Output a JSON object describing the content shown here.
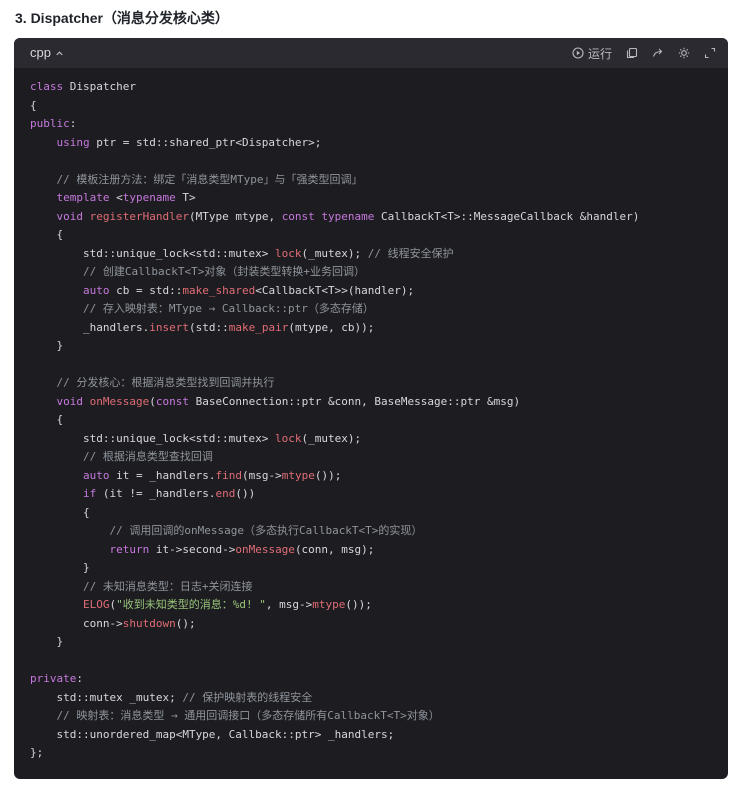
{
  "heading": "3. Dispatcher（消息分发核心类）",
  "code_block": {
    "language": "cpp",
    "run_label": "运行",
    "icons": [
      "play-icon",
      "copy-icon",
      "share-icon",
      "theme-icon",
      "expand-icon"
    ],
    "colors": {
      "background": "#1d1d21",
      "header": "#2a2a30",
      "keyword": "#c678dd",
      "function": "#e06c75",
      "comment": "#8f949c",
      "string": "#98c379",
      "text": "#d6d6dc"
    },
    "lines": [
      [
        [
          "kw",
          "class "
        ],
        [
          "tx",
          "Dispatcher"
        ]
      ],
      [
        [
          "tx",
          "{"
        ]
      ],
      [
        [
          "kw",
          "public"
        ],
        [
          "tx",
          ":"
        ]
      ],
      [
        [
          "tx",
          "    "
        ],
        [
          "kw",
          "using"
        ],
        [
          "tx",
          " ptr = std::shared_ptr<Dispatcher>;"
        ]
      ],
      [],
      [
        [
          "tx",
          "    "
        ],
        [
          "cm",
          "// 模板注册方法：绑定「消息类型MType」与「强类型回调」"
        ]
      ],
      [
        [
          "tx",
          "    "
        ],
        [
          "kw",
          "template"
        ],
        [
          "tx",
          " <"
        ],
        [
          "kw",
          "typename"
        ],
        [
          "tx",
          " T>"
        ]
      ],
      [
        [
          "tx",
          "    "
        ],
        [
          "kw",
          "void"
        ],
        [
          "tx",
          " "
        ],
        [
          "fn",
          "registerHandler"
        ],
        [
          "tx",
          "(MType mtype, "
        ],
        [
          "kw",
          "const"
        ],
        [
          "tx",
          " "
        ],
        [
          "kw",
          "typename"
        ],
        [
          "tx",
          " CallbackT<T>::MessageCallback &handler)"
        ]
      ],
      [
        [
          "tx",
          "    {"
        ]
      ],
      [
        [
          "tx",
          "        std::unique_lock<std::mutex> "
        ],
        [
          "fn",
          "lock"
        ],
        [
          "tx",
          "(_mutex); "
        ],
        [
          "cm",
          "// 线程安全保护"
        ]
      ],
      [
        [
          "tx",
          "        "
        ],
        [
          "cm",
          "// 创建CallbackT<T>对象（封装类型转换+业务回调）"
        ]
      ],
      [
        [
          "tx",
          "        "
        ],
        [
          "kw",
          "auto"
        ],
        [
          "tx",
          " cb = std::"
        ],
        [
          "fn",
          "make_shared"
        ],
        [
          "tx",
          "<CallbackT<T>>(handler);"
        ]
      ],
      [
        [
          "tx",
          "        "
        ],
        [
          "cm",
          "// 存入映射表：MType → Callback::ptr（多态存储）"
        ]
      ],
      [
        [
          "tx",
          "        _handlers."
        ],
        [
          "fn",
          "insert"
        ],
        [
          "tx",
          "(std::"
        ],
        [
          "fn",
          "make_pair"
        ],
        [
          "tx",
          "(mtype, cb));"
        ]
      ],
      [
        [
          "tx",
          "    }"
        ]
      ],
      [],
      [
        [
          "tx",
          "    "
        ],
        [
          "cm",
          "// 分发核心：根据消息类型找到回调并执行"
        ]
      ],
      [
        [
          "tx",
          "    "
        ],
        [
          "kw",
          "void"
        ],
        [
          "tx",
          " "
        ],
        [
          "fn",
          "onMessage"
        ],
        [
          "tx",
          "("
        ],
        [
          "kw",
          "const"
        ],
        [
          "tx",
          " BaseConnection::ptr &conn, BaseMessage::ptr &msg)"
        ]
      ],
      [
        [
          "tx",
          "    {"
        ]
      ],
      [
        [
          "tx",
          "        std::unique_lock<std::mutex> "
        ],
        [
          "fn",
          "lock"
        ],
        [
          "tx",
          "(_mutex);"
        ]
      ],
      [
        [
          "tx",
          "        "
        ],
        [
          "cm",
          "// 根据消息类型查找回调"
        ]
      ],
      [
        [
          "tx",
          "        "
        ],
        [
          "kw",
          "auto"
        ],
        [
          "tx",
          " it = _handlers."
        ],
        [
          "fn",
          "find"
        ],
        [
          "tx",
          "(msg->"
        ],
        [
          "fn",
          "mtype"
        ],
        [
          "tx",
          "());"
        ]
      ],
      [
        [
          "tx",
          "        "
        ],
        [
          "kw",
          "if"
        ],
        [
          "tx",
          " (it != _handlers."
        ],
        [
          "fn",
          "end"
        ],
        [
          "tx",
          "())"
        ]
      ],
      [
        [
          "tx",
          "        {"
        ]
      ],
      [
        [
          "tx",
          "            "
        ],
        [
          "cm",
          "// 调用回调的onMessage（多态执行CallbackT<T>的实现）"
        ]
      ],
      [
        [
          "tx",
          "            "
        ],
        [
          "kw",
          "return"
        ],
        [
          "tx",
          " it->second->"
        ],
        [
          "fn",
          "onMessage"
        ],
        [
          "tx",
          "(conn, msg);"
        ]
      ],
      [
        [
          "tx",
          "        }"
        ]
      ],
      [
        [
          "tx",
          "        "
        ],
        [
          "cm",
          "// 未知消息类型：日志+关闭连接"
        ]
      ],
      [
        [
          "tx",
          "        "
        ],
        [
          "fn",
          "ELOG"
        ],
        [
          "tx",
          "("
        ],
        [
          "st",
          "\"收到未知类型的消息：%d! \""
        ],
        [
          "tx",
          ", msg->"
        ],
        [
          "fn",
          "mtype"
        ],
        [
          "tx",
          "());"
        ]
      ],
      [
        [
          "tx",
          "        conn->"
        ],
        [
          "fn",
          "shutdown"
        ],
        [
          "tx",
          "();"
        ]
      ],
      [
        [
          "tx",
          "    }"
        ]
      ],
      [],
      [
        [
          "kw",
          "private"
        ],
        [
          "tx",
          ":"
        ]
      ],
      [
        [
          "tx",
          "    std::mutex _mutex; "
        ],
        [
          "cm",
          "// 保护映射表的线程安全"
        ]
      ],
      [
        [
          "tx",
          "    "
        ],
        [
          "cm",
          "// 映射表：消息类型 → 通用回调接口（多态存储所有CallbackT<T>对象）"
        ]
      ],
      [
        [
          "tx",
          "    std::unordered_map<MType, Callback::ptr> _handlers;"
        ]
      ],
      [
        [
          "tx",
          "};"
        ]
      ]
    ]
  }
}
